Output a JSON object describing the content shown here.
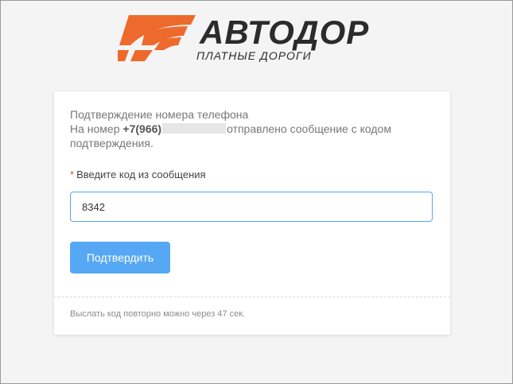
{
  "brand": {
    "name": "АВТОДОР",
    "subtitle": "ПЛАТНЫЕ ДОРОГИ",
    "logo_color": "#ee6a2c",
    "text_color": "#2b2b2b"
  },
  "card": {
    "title": "Подтверждение номера телефона",
    "message_prefix": "На номер",
    "phone_visible": "+7(966)",
    "message_suffix": "отправлено сообщение с кодом подтверждения.",
    "field_label": "Введите код из сообщения",
    "required_mark": "*",
    "code_value": "8342",
    "confirm_label": "Подтвердить",
    "resend_note": "Выслать код повторно можно через 47 сек.",
    "accent_color": "#56a8f5"
  }
}
